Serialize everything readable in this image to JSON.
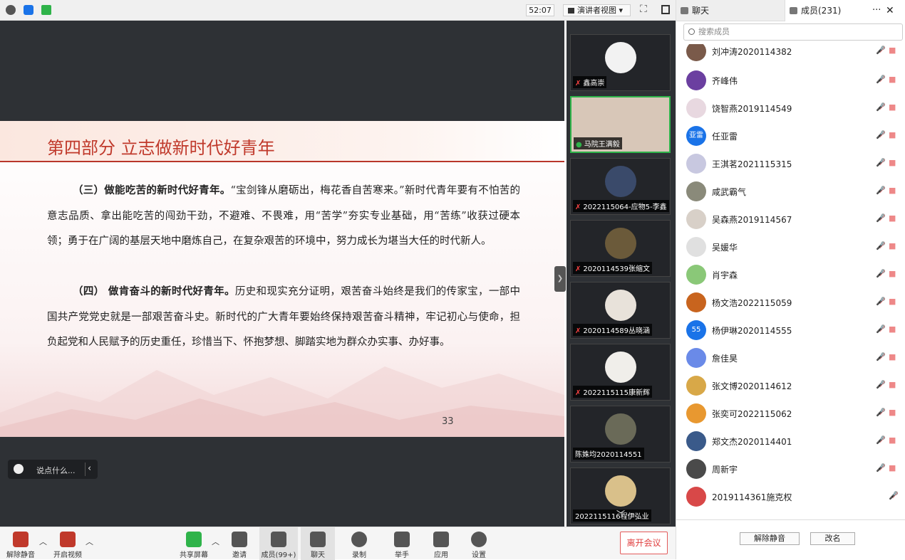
{
  "topbar": {
    "timer": "52:07",
    "view_label": "演讲者视图"
  },
  "slide": {
    "title": "第四部分 立志做新时代好青年",
    "para1_bold": "（三）做能吃苦的新时代好青年。",
    "para1_text": "“宝剑锋从磨砺出，梅花香自苦寒来。”新时代青年要有不怕苦的意志品质、拿出能吃苦的闯劲干劲，不避难、不畏难，用“苦学”夯实专业基础，用“苦练”收获过硬本领；勇于在广阔的基层天地中磨炼自己，在复杂艰苦的环境中，努力成长为堪当大任的时代新人。",
    "para2_bold": "（四） 做肯奋斗的新时代好青年。",
    "para2_text": "历史和现实充分证明，艰苦奋斗始终是我们的传家宝，一部中国共产党党史就是一部艰苦奋斗史。新时代的广大青年要始终保持艰苦奋斗精神，牢记初心与使命，担负起党和人民赋予的历史重任，珍惜当下、怀抱梦想、脚踏实地为群众办实事、办好事。",
    "page_number": "33"
  },
  "chat_input": {
    "placeholder": "说点什么..."
  },
  "gallery": {
    "tiles": [
      {
        "name": "鑫高崇",
        "color": "#f2f2f2"
      },
      {
        "name": "马院王满毅",
        "color": "#d8c7b8"
      },
      {
        "name": "2022115064-应物5-李鑫",
        "color": "#3a4a6a"
      },
      {
        "name": "2020114539张缩文",
        "color": "#6b5a3a"
      },
      {
        "name": "2020114589丛晓涵",
        "color": "#e8e2da"
      },
      {
        "name": "2022115115康新辉",
        "color": "#f0eeea"
      },
      {
        "name": "陈姝均2020114551",
        "color": "#6a6a58"
      },
      {
        "name": "2022115116程伊弘业",
        "color": "#d9c08a"
      }
    ]
  },
  "bottombar": {
    "unmute": "解除静音",
    "start_video": "开启视频",
    "share_screen": "共享屏幕",
    "invite": "邀请",
    "members": "成员(99+)",
    "chat": "聊天",
    "record": "录制",
    "raise_hand": "举手",
    "apps": "应用",
    "settings": "设置",
    "leave": "离开会议"
  },
  "panel": {
    "tab_chat": "聊天",
    "tab_members": "成员(231)",
    "search_placeholder": "搜索成员",
    "members": [
      {
        "name": "刘冲涛2020114382",
        "color": "#7a5a4a",
        "initials": ""
      },
      {
        "name": "齐峰伟",
        "color": "#6b3fa0",
        "initials": ""
      },
      {
        "name": "饶智燕2019114549",
        "color": "#e8d8e0",
        "initials": ""
      },
      {
        "name": "任亚雷",
        "color": "#1a73e8",
        "initials": "亚雷"
      },
      {
        "name": "王淇茗2021115315",
        "color": "#c8c8e0",
        "initials": ""
      },
      {
        "name": "咸武霸气",
        "color": "#8a8a7a",
        "initials": ""
      },
      {
        "name": "吴森燕2019114567",
        "color": "#d8d0c8",
        "initials": ""
      },
      {
        "name": "吴媛华",
        "color": "#e0e0e0",
        "initials": ""
      },
      {
        "name": "肖宇森",
        "color": "#8ac878",
        "initials": ""
      },
      {
        "name": "杨文浩2022115059",
        "color": "#c8641e",
        "initials": ""
      },
      {
        "name": "杨伊琳2020114555",
        "color": "#1a73e8",
        "initials": "55"
      },
      {
        "name": "詹佳昊",
        "color": "#6a8ae8",
        "initials": ""
      },
      {
        "name": "张文博2020114612",
        "color": "#d8a848",
        "initials": ""
      },
      {
        "name": "张奕可2022115062",
        "color": "#e89830",
        "initials": ""
      },
      {
        "name": "郑文杰2020114401",
        "color": "#3a5a8a",
        "initials": ""
      },
      {
        "name": "周新宇",
        "color": "#4a4a4a",
        "initials": ""
      },
      {
        "name": "2019114361施克权",
        "color": "#d84848",
        "initials": ""
      }
    ],
    "unmute_all": "解除静音",
    "rename": "改名"
  }
}
